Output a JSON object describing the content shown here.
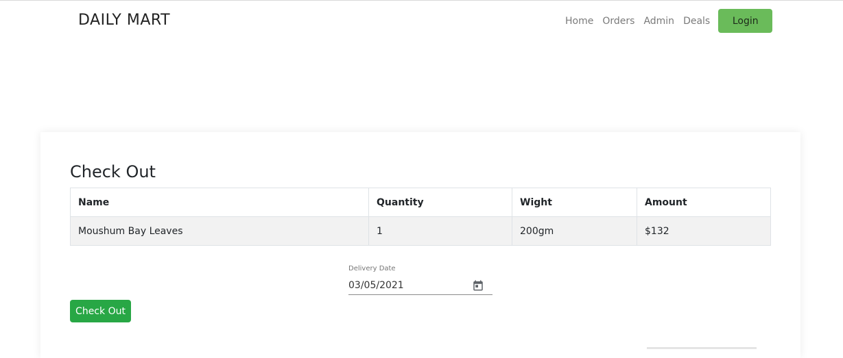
{
  "brand": "DAILY MART",
  "nav": {
    "links": [
      "Home",
      "Orders",
      "Admin",
      "Deals"
    ],
    "login_label": "Login"
  },
  "checkout": {
    "title": "Check Out",
    "columns": [
      "Name",
      "Quantity",
      "Wight",
      "Amount"
    ],
    "rows": [
      {
        "name": "Moushum Bay Leaves",
        "quantity": "1",
        "weight": "200gm",
        "amount": "$132"
      }
    ],
    "delivery_label": "Delivery Date",
    "delivery_value": "03/05/2021",
    "button_label": "Check Out"
  },
  "colors": {
    "login_button": "#6abb5a",
    "checkout_button": "#28a745",
    "row_bg": "#f2f2f2"
  }
}
